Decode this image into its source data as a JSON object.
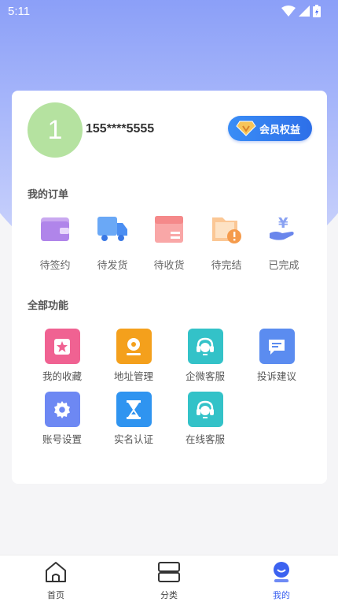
{
  "status": {
    "time": "5:11"
  },
  "profile": {
    "avatar_letter": "1",
    "phone": "155****5555",
    "vip_label": "会员权益"
  },
  "orders": {
    "title": "我的订单",
    "items": [
      {
        "label": "待签约",
        "icon": "wallet-icon"
      },
      {
        "label": "待发货",
        "icon": "truck-icon"
      },
      {
        "label": "待收货",
        "icon": "package-icon"
      },
      {
        "label": "待完结",
        "icon": "folder-alert-icon"
      },
      {
        "label": "已完成",
        "icon": "yen-hand-icon"
      }
    ]
  },
  "functions": {
    "title": "全部功能",
    "items": [
      {
        "label": "我的收藏",
        "icon": "star-icon",
        "color": "#f06292"
      },
      {
        "label": "地址管理",
        "icon": "location-icon",
        "color": "#f4a01c"
      },
      {
        "label": "企微客服",
        "icon": "headset-icon",
        "color": "#33c2c8"
      },
      {
        "label": "投诉建议",
        "icon": "chat-icon",
        "color": "#5b8cf0"
      },
      {
        "label": "账号设置",
        "icon": "gear-icon",
        "color": "#6d88f3"
      },
      {
        "label": "实名认证",
        "icon": "hourglass-icon",
        "color": "#2f94f0"
      },
      {
        "label": "在线客服",
        "icon": "headset-icon",
        "color": "#33c2c8"
      }
    ]
  },
  "tabs": [
    {
      "label": "首页",
      "icon": "home-icon"
    },
    {
      "label": "分类",
      "icon": "category-icon"
    },
    {
      "label": "我的",
      "icon": "profile-icon"
    }
  ],
  "colors": {
    "accent": "#3c62f0",
    "header_gradient_top": "#4a6cf4"
  }
}
